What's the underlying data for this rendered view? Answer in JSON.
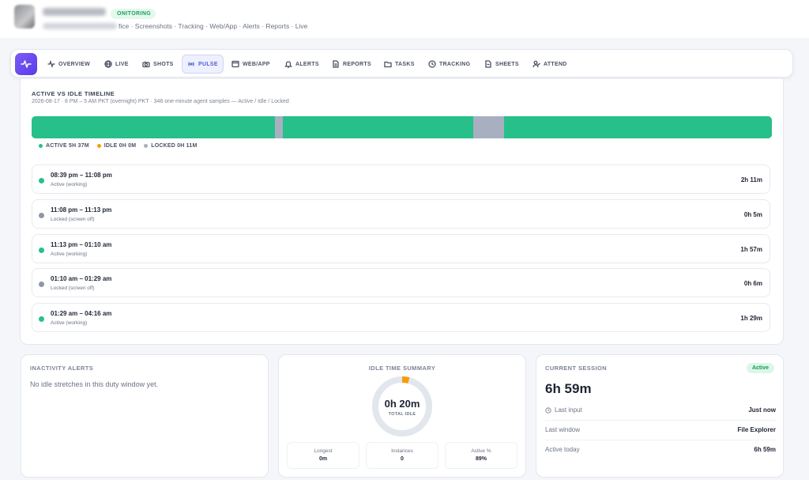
{
  "header": {
    "status_badge": "ONITORING",
    "breadcrumb": "fice · Screenshots · Tracking · Web/App · Alerts · Reports · Live"
  },
  "nav": {
    "items": [
      {
        "label": "OVERVIEW",
        "icon": "activity-icon"
      },
      {
        "label": "LIVE",
        "icon": "globe-icon"
      },
      {
        "label": "SHOTS",
        "icon": "camera-icon"
      },
      {
        "label": "PULSE",
        "icon": "pulse-icon",
        "active": true
      },
      {
        "label": "WEB/APP",
        "icon": "window-icon"
      },
      {
        "label": "ALERTS",
        "icon": "bell-icon"
      },
      {
        "label": "REPORTS",
        "icon": "document-icon"
      },
      {
        "label": "TASKS",
        "icon": "folder-icon"
      },
      {
        "label": "TRACKING",
        "icon": "clock-icon"
      },
      {
        "label": "SHEETS",
        "icon": "sheet-icon"
      },
      {
        "label": "ATTEND",
        "icon": "user-check-icon"
      }
    ]
  },
  "timeline": {
    "title": "ACTIVE VS IDLE TIMELINE",
    "subtitle": "2026-08-17 · 8 PM – 5 AM PKT (overnight) PKT · 348 one-minute agent samples — Active / Idle / Locked",
    "segments": [
      {
        "state": "active",
        "fraction": 0.3289
      },
      {
        "state": "locked",
        "fraction": 0.0108
      },
      {
        "state": "active",
        "fraction": 0.2564
      },
      {
        "state": "locked",
        "fraction": 0.0423
      },
      {
        "state": "active",
        "fraction": 0.3616
      }
    ],
    "legend": {
      "active": "ACTIVE 5H 37M",
      "idle": "IDLE 0H 0M",
      "locked": "LOCKED 0H 11M"
    },
    "colors": {
      "active": "#27c08a",
      "idle": "#f59e0b",
      "locked": "#a7afc0"
    },
    "rows": [
      {
        "time": "08:39 pm – 11:08 pm",
        "state": "Active (working)",
        "duration": "2h 11m",
        "kind": "active"
      },
      {
        "time": "11:08 pm – 11:13 pm",
        "state": "Locked (screen off)",
        "duration": "0h 5m",
        "kind": "locked"
      },
      {
        "time": "11:13 pm – 01:10 am",
        "state": "Active (working)",
        "duration": "1h 57m",
        "kind": "active"
      },
      {
        "time": "01:10 am – 01:29 am",
        "state": "Locked (screen off)",
        "duration": "0h 6m",
        "kind": "locked"
      },
      {
        "time": "01:29 am – 04:16 am",
        "state": "Active (working)",
        "duration": "1h 29m",
        "kind": "active"
      }
    ]
  },
  "inactivity": {
    "title": "INACTIVITY ALERTS",
    "empty_text": "No idle stretches in this duty window yet."
  },
  "idle_summary": {
    "title": "IDLE TIME SUMMARY",
    "total": "0h 20m",
    "total_label": "TOTAL IDLE",
    "stats": [
      {
        "label": "Longest",
        "value": "0m"
      },
      {
        "label": "Instances",
        "value": "0"
      },
      {
        "label": "Active %",
        "value": "89%"
      }
    ]
  },
  "session": {
    "title": "CURRENT SESSION",
    "badge": "Active",
    "duration": "6h 59m",
    "rows": [
      {
        "label": "Last input",
        "value": "Just now"
      },
      {
        "label": "Last window",
        "value": "File Explorer"
      },
      {
        "label": "Active today",
        "value": "6h 59m"
      }
    ]
  }
}
